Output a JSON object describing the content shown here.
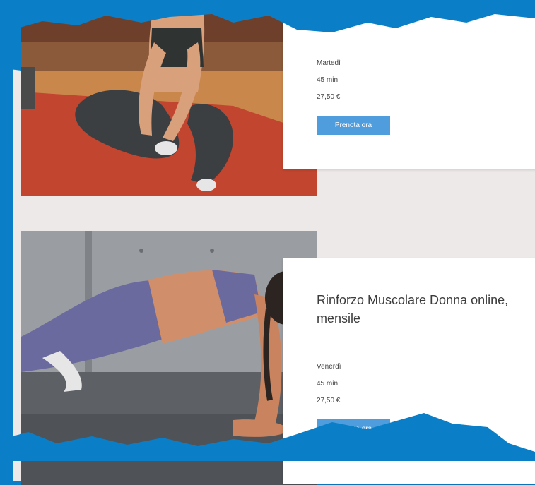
{
  "colors": {
    "frame_blue": "#0a7fc7",
    "page_bg": "#ece9e8",
    "button_blue": "#4f9ddc",
    "card_bg": "#ffffff"
  },
  "classes": [
    {
      "photo": "woman-seated-stretching-on-mat",
      "title": "",
      "day": "Martedì",
      "duration": "45 min",
      "price": "27,50 €",
      "cta_label": "Prenota ora"
    },
    {
      "photo": "woman-doing-plank",
      "title": "Rinforzo Muscolare Donna online, mensile",
      "day": "Venerdì",
      "duration": "45 min",
      "price": "27,50 €",
      "cta_label": "Prenota ora"
    }
  ]
}
